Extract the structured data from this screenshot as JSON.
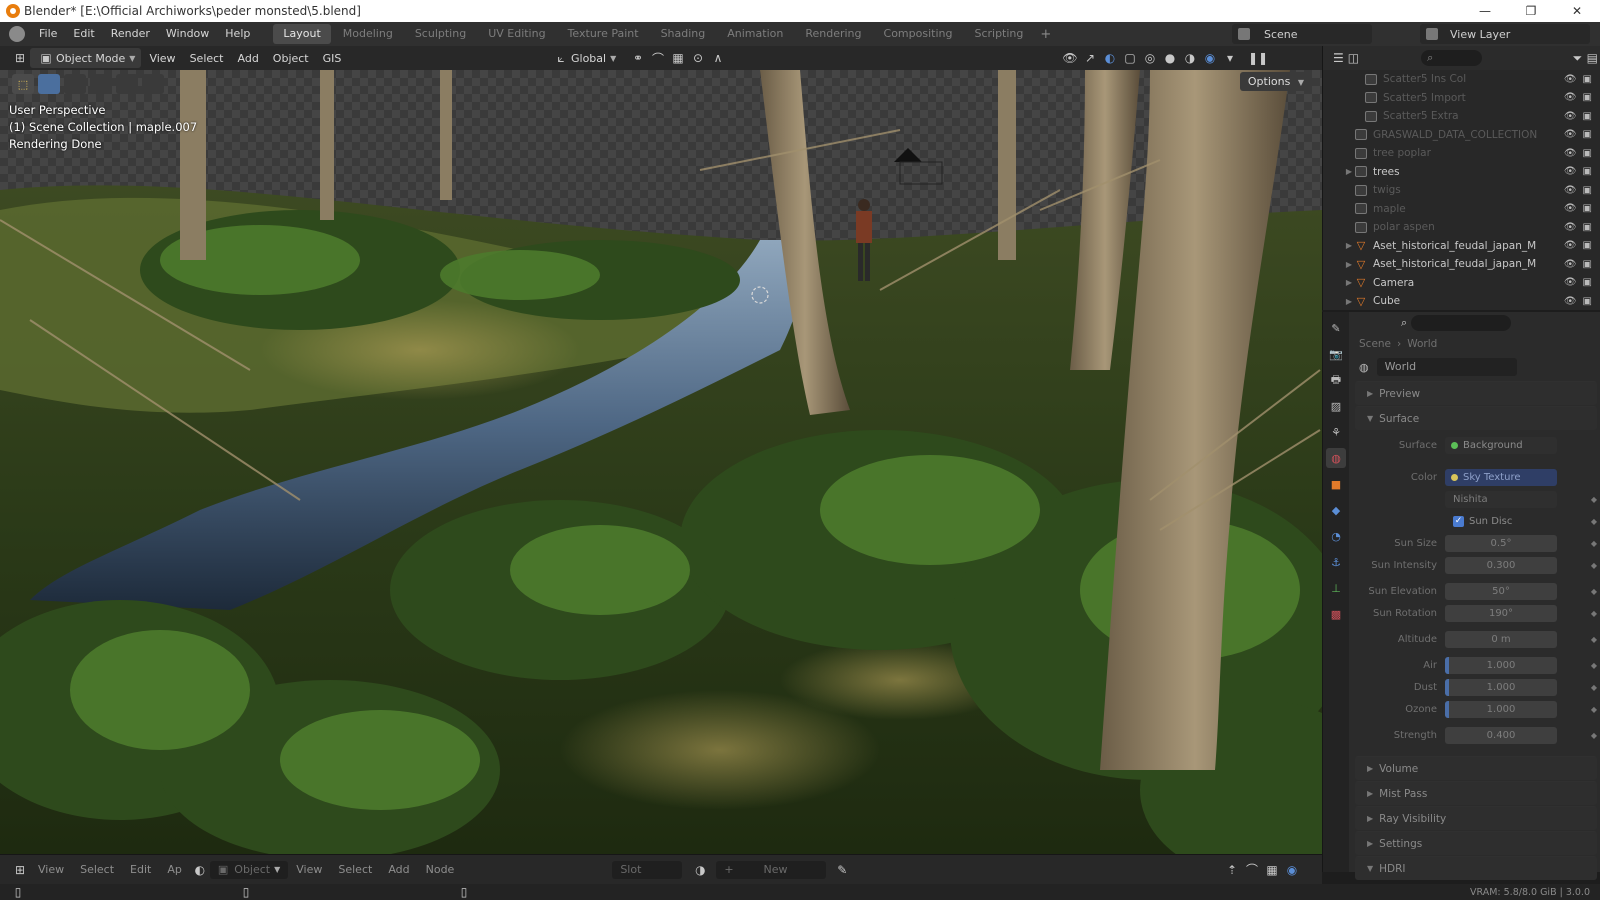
{
  "window": {
    "title": "Blender* [E:\\Official Archiworks\\peder monsted\\5.blend]",
    "controls": [
      "—",
      "❐",
      "✕"
    ]
  },
  "menu": {
    "items": [
      "File",
      "Edit",
      "Render",
      "Window",
      "Help"
    ],
    "workspaces": [
      "Layout",
      "Modeling",
      "Sculpting",
      "UV Editing",
      "Texture Paint",
      "Shading",
      "Animation",
      "Rendering",
      "Compositing",
      "Scripting"
    ],
    "active_workspace": "Layout",
    "add_symbol": "+",
    "scene": "Scene",
    "view_layer": "View Layer"
  },
  "viewport_header": {
    "mode": "Object Mode",
    "menus": [
      "View",
      "Select",
      "Add",
      "Object",
      "GIS"
    ],
    "orientation": "Global"
  },
  "viewport": {
    "overlay_lines": [
      "User Perspective",
      "(1) Scene Collection | maple.007",
      "Rendering Done"
    ],
    "options_label": "Options"
  },
  "outliner": {
    "rows": [
      {
        "label": "Scatter5 Ins Col",
        "kind": "coll",
        "bright": false
      },
      {
        "label": "Scatter5 Import",
        "kind": "coll",
        "bright": false
      },
      {
        "label": "Scatter5 Extra",
        "kind": "coll",
        "bright": false
      },
      {
        "label": "GRASWALD_DATA_COLLECTION",
        "kind": "coll",
        "bright": false
      },
      {
        "label": "tree poplar",
        "kind": "coll",
        "bright": false
      },
      {
        "label": "trees",
        "kind": "coll",
        "bright": true
      },
      {
        "label": "twigs",
        "kind": "coll",
        "bright": false
      },
      {
        "label": "maple",
        "kind": "coll",
        "bright": false
      },
      {
        "label": "polar aspen",
        "kind": "coll",
        "bright": false
      },
      {
        "label": "Aset_historical_feudal_japan_M",
        "kind": "obj",
        "bright": true
      },
      {
        "label": "Aset_historical_feudal_japan_M",
        "kind": "obj",
        "bright": true
      },
      {
        "label": "Camera",
        "kind": "obj",
        "bright": true
      },
      {
        "label": "Cube",
        "kind": "obj",
        "bright": true
      }
    ]
  },
  "properties": {
    "breadcrumb": [
      "Scene",
      "World"
    ],
    "world_name": "World",
    "panels_top": [
      "Preview",
      "Surface"
    ],
    "surface": {
      "surface_label": "Surface",
      "surface_value": "Background",
      "color_label": "Color",
      "color_value": "Sky Texture",
      "sky_type": "Nishita",
      "sun_disc_label": "Sun Disc",
      "fields": [
        {
          "label": "Sun Size",
          "value": "0.5°"
        },
        {
          "label": "Sun Intensity",
          "value": "0.300"
        },
        {
          "label": "Sun Elevation",
          "value": "50°"
        },
        {
          "label": "Sun Rotation",
          "value": "190°"
        },
        {
          "label": "Altitude",
          "value": "0 m"
        },
        {
          "label": "Air",
          "value": "1.000"
        },
        {
          "label": "Dust",
          "value": "1.000"
        },
        {
          "label": "Ozone",
          "value": "1.000"
        },
        {
          "label": "Strength",
          "value": "0.400"
        }
      ]
    },
    "panels_bottom": [
      "Volume",
      "Mist Pass",
      "Ray Visibility",
      "Settings",
      "HDRI"
    ]
  },
  "bottom_header": {
    "menus_left": [
      "View",
      "Select",
      "Edit",
      "Ap"
    ],
    "editor_type": "Object",
    "menus_right": [
      "View",
      "Select",
      "Add",
      "Node"
    ],
    "slot": "Slot",
    "new_label": "New"
  },
  "status": {
    "vram": "VRAM: 5.8/8.0 GiB | 3.0.0"
  }
}
